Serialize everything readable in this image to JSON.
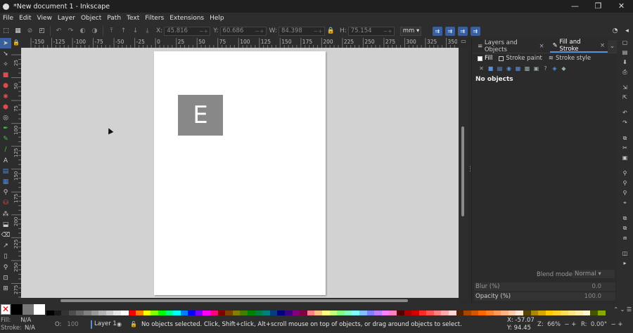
{
  "window": {
    "title": "*New document 1 - Inkscape",
    "min": "—",
    "max": "❐",
    "close": "✕"
  },
  "menu": [
    "File",
    "Edit",
    "View",
    "Layer",
    "Object",
    "Path",
    "Text",
    "Filters",
    "Extensions",
    "Help"
  ],
  "toolcontrols": {
    "x_label": "X:",
    "x_value": "45.816",
    "y_label": "Y:",
    "y_value": "60.686",
    "w_label": "W:",
    "w_value": "84.398",
    "h_label": "H:",
    "h_value": "75.154",
    "unit": "mm ▾"
  },
  "ruler_h": [
    "-150",
    "-125",
    "-100",
    "-75",
    "-50",
    "-25",
    "0",
    "25",
    "50",
    "75",
    "100",
    "125",
    "150",
    "175",
    "200",
    "225",
    "250",
    "275",
    "300",
    "325",
    "350"
  ],
  "ruler_v": [
    "25",
    "50",
    "75",
    "100",
    "125",
    "150",
    "175",
    "200",
    "225",
    "250",
    "275"
  ],
  "canvas": {
    "text_object": "E"
  },
  "dock": {
    "tabs": [
      {
        "label": "Layers and Objects",
        "close": "×"
      },
      {
        "label": "Fill and Stroke",
        "close": "×"
      }
    ],
    "subtabs": [
      "Fill",
      "Stroke paint",
      "Stroke style"
    ],
    "no_objects": "No objects",
    "blend_label": "Blend mode:",
    "blend_value": "Normal ▾",
    "blur_label": "Blur (%)",
    "blur_value": "0.0",
    "opacity_label": "Opacity (%)",
    "opacity_value": "100.0"
  },
  "status": {
    "fill_label": "Fill:",
    "fill_value": "N/A",
    "stroke_label": "Stroke:",
    "stroke_value": "N/A",
    "opacity_label": "O:",
    "opacity_value": "100",
    "layer": "Layer 1",
    "message": "No objects selected. Click, Shift+click, Alt+scroll mouse on top of objects, or drag around objects to select.",
    "x_coord": "X:  -57.07",
    "y_coord": "Y:  94.45",
    "zoom_label": "Z:",
    "zoom_value": "66%",
    "rotation_label": "R:",
    "rotation_value": "0.00°"
  },
  "colors": {
    "accent": "#3a5f9a",
    "canvas_bg": "#d2d2d2",
    "page": "#ffffff",
    "text_box": "#888889"
  },
  "palette": [
    "#000000",
    "#1a1a1a",
    "#333333",
    "#4d4d4d",
    "#666666",
    "#808080",
    "#999999",
    "#b3b3b3",
    "#cccccc",
    "#e6e6e6",
    "#ffffff",
    "#ff0000",
    "#ff8000",
    "#ffff00",
    "#80ff00",
    "#00ff00",
    "#00ff80",
    "#00ffff",
    "#0080ff",
    "#0000ff",
    "#8000ff",
    "#ff00ff",
    "#ff0080",
    "#800000",
    "#804000",
    "#808000",
    "#408000",
    "#008000",
    "#008040",
    "#008080",
    "#004080",
    "#000080",
    "#400080",
    "#800080",
    "#800040",
    "#ff8080",
    "#ffbf80",
    "#ffff80",
    "#bfff80",
    "#80ff80",
    "#80ffbf",
    "#80ffff",
    "#80bfff",
    "#8080ff",
    "#bf80ff",
    "#ff80ff",
    "#ff80bf",
    "#550000",
    "#aa0000",
    "#d40000",
    "#ff2a2a",
    "#ff5555",
    "#ff8080",
    "#ffaaaa",
    "#ffd5d5",
    "#552200",
    "#aa4400",
    "#d45500",
    "#ff6600",
    "#ff7f2a",
    "#ff9955",
    "#ffb380",
    "#ffccaa",
    "#ffe6d5",
    "#554400",
    "#aa8800",
    "#d4aa00",
    "#ffcc00",
    "#ffd42a",
    "#ffdd55",
    "#ffe680",
    "#ffeeaa",
    "#fff6d5",
    "#445500",
    "#88aa00"
  ]
}
